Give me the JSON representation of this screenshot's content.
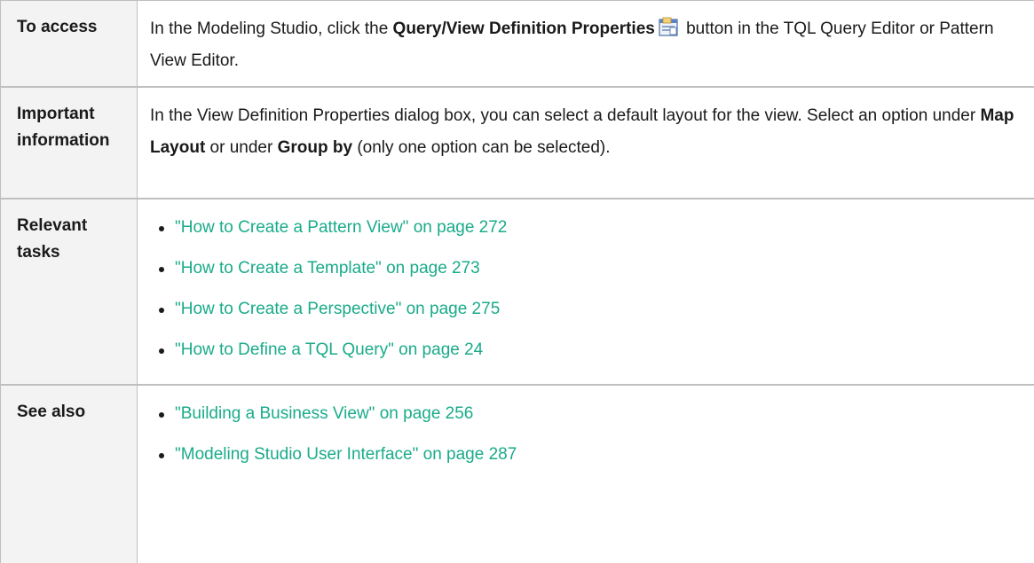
{
  "rows": {
    "access": {
      "label": "To access",
      "text_1": "In the Modeling Studio, click the ",
      "button_name": "Query/View Definition Properties",
      "text_2": " button in the TQL Query Editor or Pattern View Editor.",
      "icon": "properties-icon"
    },
    "info": {
      "label_line1": "Important",
      "label_line2": "information",
      "text_1": "In the View Definition Properties dialog box, you can select a default layout for the view. Select an option under ",
      "opt1": "Map Layout",
      "text_2": " or under ",
      "opt2": "Group by",
      "text_3": " (only one option can be selected)."
    },
    "tasks": {
      "label_line1": "Relevant",
      "label_line2": "tasks",
      "links": [
        "\"How to Create a Pattern View\" on page 272",
        "\"How to Create a Template\" on page 273",
        "\"How to Create a Perspective\" on page 275",
        "\"How to Define a TQL Query\" on page 24"
      ]
    },
    "see_also": {
      "label": "See also",
      "links": [
        "\"Building a Business View\" on page 256",
        "\"Modeling Studio User Interface\" on page 287"
      ]
    }
  },
  "colors": {
    "link": "#1aab8a",
    "label_bg": "#f3f3f3",
    "border": "#bfbfbf"
  }
}
